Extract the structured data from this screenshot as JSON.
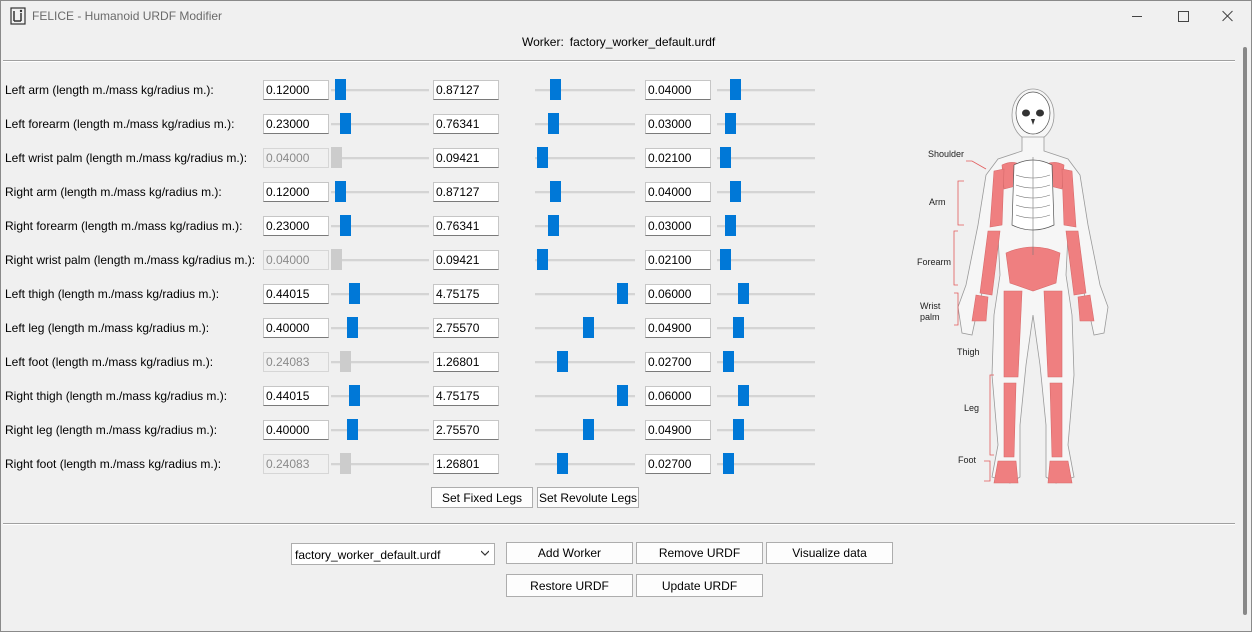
{
  "window": {
    "title": "FELICE - Humanoid URDF Modifier"
  },
  "header": {
    "worker_prefix": "Worker:",
    "worker_file": "factory_worker_default.urdf"
  },
  "rows": [
    {
      "label": "Left arm (length m./mass kg/radius m.):",
      "length": "0.12000",
      "mass": "0.87127",
      "radius": "0.04000",
      "length_enabled": true,
      "length_level": 0.09,
      "mass_level": 0.2,
      "radius_level": 0.18
    },
    {
      "label": "Left forearm (length m./mass kg/radius m.):",
      "length": "0.23000",
      "mass": "0.76341",
      "radius": "0.03000",
      "length_enabled": true,
      "length_level": 0.14,
      "mass_level": 0.18,
      "radius_level": 0.13
    },
    {
      "label": "Left wrist palm (length m./mass kg/radius m.):",
      "length": "0.04000",
      "mass": "0.09421",
      "radius": "0.02100",
      "length_enabled": false,
      "length_level": 0.05,
      "mass_level": 0.07,
      "radius_level": 0.08
    },
    {
      "label": "Right arm (length m./mass kg/radius m.):",
      "length": "0.12000",
      "mass": "0.87127",
      "radius": "0.04000",
      "length_enabled": true,
      "length_level": 0.09,
      "mass_level": 0.2,
      "radius_level": 0.18
    },
    {
      "label": "Right forearm (length m./mass kg/radius m.):",
      "length": "0.23000",
      "mass": "0.76341",
      "radius": "0.03000",
      "length_enabled": true,
      "length_level": 0.14,
      "mass_level": 0.18,
      "radius_level": 0.13
    },
    {
      "label": "Right wrist palm (length m./mass kg/radius m.):",
      "length": "0.04000",
      "mass": "0.09421",
      "radius": "0.02100",
      "length_enabled": false,
      "length_level": 0.05,
      "mass_level": 0.07,
      "radius_level": 0.08
    },
    {
      "label": "Left thigh (length m./mass kg/radius m.):",
      "length": "0.44015",
      "mass": "4.75175",
      "radius": "0.06000",
      "length_enabled": true,
      "length_level": 0.23,
      "mass_level": 0.87,
      "radius_level": 0.27
    },
    {
      "label": "Left leg (length m./mass kg/radius m.):",
      "length": "0.40000",
      "mass": "2.75570",
      "radius": "0.04900",
      "length_enabled": true,
      "length_level": 0.21,
      "mass_level": 0.53,
      "radius_level": 0.21
    },
    {
      "label": "Left foot (length m./mass kg/radius m.):",
      "length": "0.24083",
      "mass": "1.26801",
      "radius": "0.02700",
      "length_enabled": false,
      "length_level": 0.14,
      "mass_level": 0.27,
      "radius_level": 0.11
    },
    {
      "label": "Right thigh (length m./mass kg/radius m.):",
      "length": "0.44015",
      "mass": "4.75175",
      "radius": "0.06000",
      "length_enabled": true,
      "length_level": 0.23,
      "mass_level": 0.87,
      "radius_level": 0.27
    },
    {
      "label": "Right leg (length m./mass kg/radius m.):",
      "length": "0.40000",
      "mass": "2.75570",
      "radius": "0.04900",
      "length_enabled": true,
      "length_level": 0.21,
      "mass_level": 0.53,
      "radius_level": 0.21
    },
    {
      "label": "Right foot (length m./mass kg/radius m.):",
      "length": "0.24083",
      "mass": "1.26801",
      "radius": "0.02700",
      "length_enabled": false,
      "length_level": 0.14,
      "mass_level": 0.27,
      "radius_level": 0.11
    }
  ],
  "leg_buttons": {
    "fixed": "Set Fixed Legs",
    "revolute": "Set Revolute Legs"
  },
  "footer": {
    "selected_file": "factory_worker_default.urdf",
    "add_worker": "Add Worker",
    "remove_urdf": "Remove URDF",
    "visualize": "Visualize data",
    "restore": "Restore URDF",
    "update": "Update URDF"
  },
  "figure": {
    "labels": {
      "shoulder": "Shoulder",
      "arm": "Arm",
      "forearm": "Forearm",
      "wrist": "Wrist",
      "palm": "palm",
      "thigh": "Thigh",
      "leg": "Leg",
      "foot": "Foot"
    },
    "highlight_color": "#ef7f80",
    "bone_color": "#ffffff"
  },
  "colors": {
    "slider_thumb": "#0078d7",
    "slider_thumb_disabled": "#cccccc"
  }
}
